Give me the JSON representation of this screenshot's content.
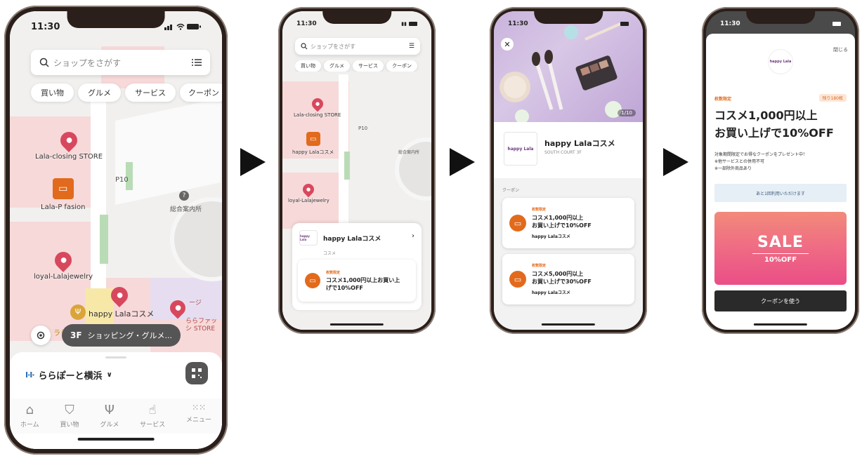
{
  "status": {
    "time": "11:30"
  },
  "phone1": {
    "search_placeholder": "ショップをさがす",
    "chips": [
      "買い物",
      "グルメ",
      "サービス",
      "クーポン"
    ],
    "pins": {
      "closing": "Lala-closing STORE",
      "fasion": "Lala-P fasion",
      "jewelry": "loyal-Lalajewelry",
      "happy": "happy Lalaコスメ",
      "lala_fashion": "ららファッシ STORE",
      "ra": "ララ",
      "service_partial": "ージ"
    },
    "map_labels": {
      "p10": "P10",
      "info": "総合案内所"
    },
    "floor_pill": {
      "floor": "3F",
      "text": "ショッピング・グルメ..."
    },
    "mall_name": "ららぽーと横浜",
    "tabs": [
      "ホーム",
      "買い物",
      "グルメ",
      "サービス",
      "メニュー"
    ]
  },
  "phone2": {
    "search_placeholder": "ショップをさがす",
    "chips": [
      "買い物",
      "グルメ",
      "サービス",
      "クーポン"
    ],
    "pins": {
      "closing": "Lala-closing STORE",
      "happy": "happy Lalaコスメ",
      "jewelry": "loyal-Lalajewelry"
    },
    "map_labels": {
      "p10": "P10",
      "info": "総合案内所"
    },
    "sheet": {
      "shop_name": "happy Lalaコスメ",
      "category": "コスメ",
      "logo": "happy Lala",
      "coupon_tag": "枚数限定",
      "coupon_text": "コスメ1,000円以上お買い上げで10%OFF"
    }
  },
  "phone3": {
    "photo_counter": "1/10",
    "shop_name": "happy Lalaコスメ",
    "location": "SOUTH COURT 3F",
    "logo": "happy Lala",
    "section": "クーポン",
    "coupons": [
      {
        "tag": "枚数限定",
        "line1": "コスメ1,000円以上",
        "line2": "お買い上げで10%OFF",
        "shop": "happy Lalaコスメ"
      },
      {
        "tag": "枚数限定",
        "line1": "コスメ5,000円以上",
        "line2": "お買い上げで30%OFF",
        "shop": "happy Lalaコスメ"
      }
    ]
  },
  "phone4": {
    "close": "閉じる",
    "logo": "happy Lala",
    "tag": "枚数限定",
    "remaining": "残り180枚",
    "title_line1": "コスメ1,000円以上",
    "title_line2": "お買い上げで10%OFF",
    "desc1": "対象期間限定でお得なクーポンをプレゼント中！",
    "desc2": "※他サービスとの併用不可",
    "desc3": "※一部除外商品あり",
    "uses_left": "あと1回利用いただけます",
    "sale_title": "SALE",
    "sale_sub": "10%OFF",
    "use_button": "クーポンを使う"
  },
  "colors": {
    "accent_orange": "#e26a1c",
    "pin_red": "#d8485d",
    "dark": "#2a2a2a"
  }
}
